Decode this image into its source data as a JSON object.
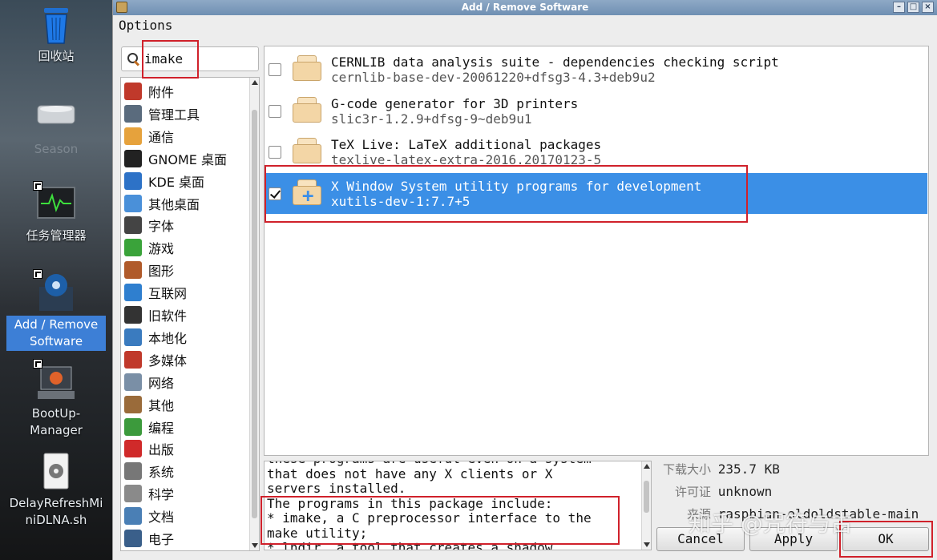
{
  "desktop": {
    "icons": [
      {
        "label": "回收站",
        "icon": "trash-icon"
      },
      {
        "label": "Season",
        "icon": "drive-icon"
      },
      {
        "label": "任务管理器",
        "icon": "task-manager-icon"
      },
      {
        "label": "Add / Remove Software",
        "icon": "package-icon"
      },
      {
        "label": "BootUp-Manager",
        "icon": "bootup-icon"
      },
      {
        "label": "DelayRefreshMiniDLNA.sh",
        "icon": "script-gear-icon"
      }
    ]
  },
  "window": {
    "title": "Add / Remove Software",
    "menu": {
      "options": "Options"
    }
  },
  "search": {
    "value": "imake"
  },
  "categories": [
    {
      "label": "附件",
      "icon": "accessories-icon",
      "color": "#c0392b"
    },
    {
      "label": "管理工具",
      "icon": "admin-tools-icon",
      "color": "#5a6b7d"
    },
    {
      "label": "通信",
      "icon": "communication-icon",
      "color": "#e6a23c"
    },
    {
      "label": "GNOME 桌面",
      "icon": "gnome-icon",
      "color": "#222222"
    },
    {
      "label": "KDE 桌面",
      "icon": "kde-icon",
      "color": "#2d72c7"
    },
    {
      "label": "其他桌面",
      "icon": "other-desktop-icon",
      "color": "#4a90d9"
    },
    {
      "label": "字体",
      "icon": "fonts-icon",
      "color": "#444444"
    },
    {
      "label": "游戏",
      "icon": "games-icon",
      "color": "#3aa33a"
    },
    {
      "label": "图形",
      "icon": "graphics-icon",
      "color": "#b05a2a"
    },
    {
      "label": "互联网",
      "icon": "internet-icon",
      "color": "#2f7fcf"
    },
    {
      "label": "旧软件",
      "icon": "legacy-icon",
      "color": "#333333"
    },
    {
      "label": "本地化",
      "icon": "localization-icon",
      "color": "#3a7bbf"
    },
    {
      "label": "多媒体",
      "icon": "multimedia-icon",
      "color": "#c0392b"
    },
    {
      "label": "网络",
      "icon": "network-icon",
      "color": "#7a8fa6"
    },
    {
      "label": "其他",
      "icon": "other-icon",
      "color": "#9a6b3a"
    },
    {
      "label": "编程",
      "icon": "programming-icon",
      "color": "#3c9a3c"
    },
    {
      "label": "出版",
      "icon": "publishing-icon",
      "color": "#d02a2a"
    },
    {
      "label": "系统",
      "icon": "system-icon",
      "color": "#777777"
    },
    {
      "label": "科学",
      "icon": "science-icon",
      "color": "#8a8a8a"
    },
    {
      "label": "文档",
      "icon": "documentation-icon",
      "color": "#4a7fb5"
    },
    {
      "label": "电子",
      "icon": "electronics-icon",
      "color": "#3a5f8a"
    }
  ],
  "packages": [
    {
      "title": "CERNLIB data analysis suite - dependencies checking script",
      "version": "cernlib-base-dev-20061220+dfsg3-4.3+deb9u2",
      "checked": false,
      "selected": false
    },
    {
      "title": "G-code generator for 3D printers",
      "version": "slic3r-1.2.9+dfsg-9~deb9u1",
      "checked": false,
      "selected": false
    },
    {
      "title": "TeX Live: LaTeX additional packages",
      "version": "texlive-latex-extra-2016.20170123-5",
      "checked": false,
      "selected": false
    },
    {
      "title": "X Window System utility programs for development",
      "version": "xutils-dev-1:7.7+5",
      "checked": true,
      "selected": true
    }
  ],
  "description": {
    "lines": [
      "these programs are useful even on a system",
      "that does not have any X clients or X",
      "servers installed.",
      "The programs in this package include:",
      "* imake, a C preprocessor interface to the",
      "make utility;",
      "* lndir, a tool that creates a shadow"
    ]
  },
  "details": {
    "size_label": "下载大小",
    "size_value": "235.7 KB",
    "license_label": "许可证",
    "license_value": "unknown",
    "source_label": "来源",
    "source_value": "raspbian-oldoldstable-main"
  },
  "buttons": {
    "cancel": "Cancel",
    "apply": "Apply",
    "ok": "OK"
  },
  "watermark": "知乎 @咒符与古"
}
